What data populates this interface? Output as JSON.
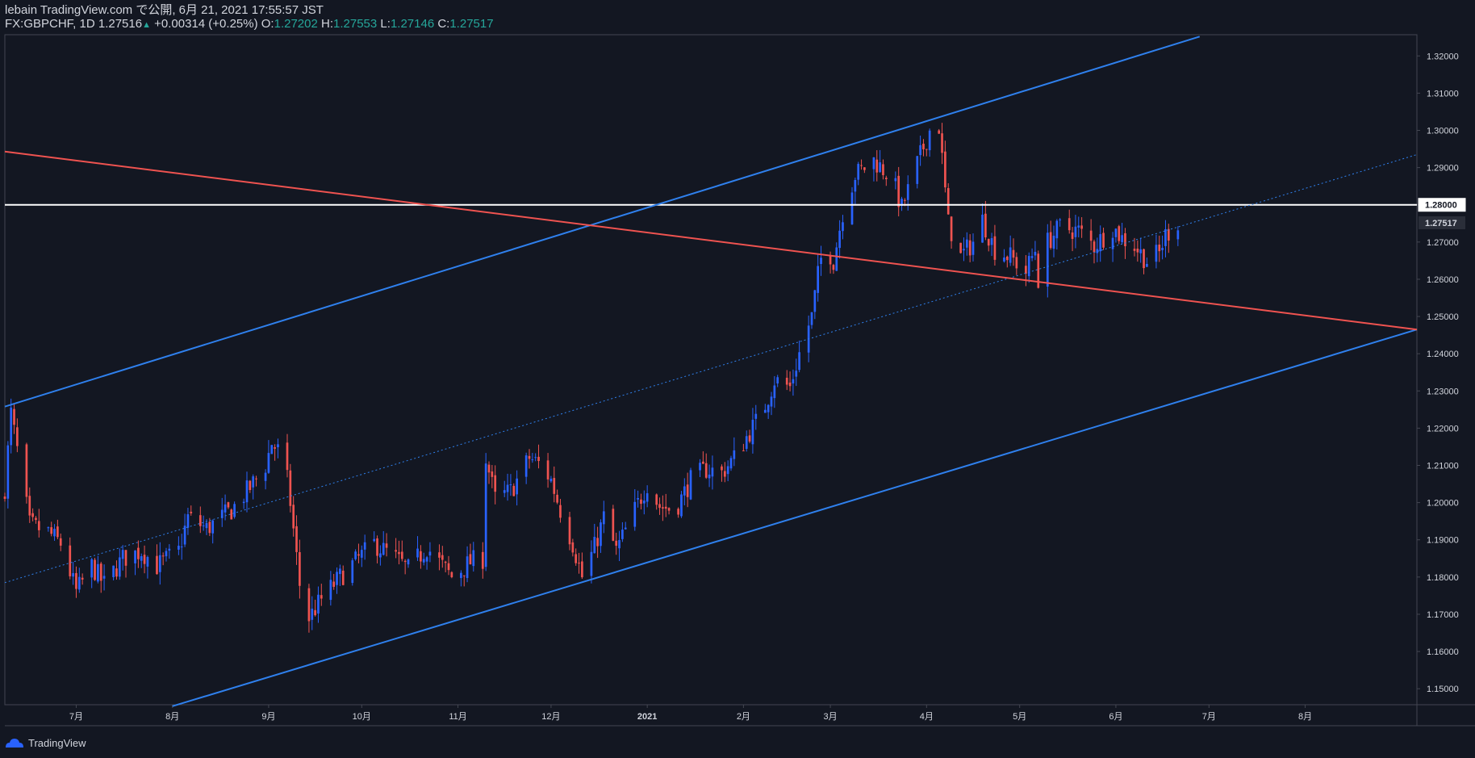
{
  "header": {
    "line1": "lebain TradingView.com で公開, 6月 21, 2021 17:55:57 JST",
    "symbol": "FX:GBPCHF, 1D",
    "last": "1.27516",
    "change": "+0.00314 (+0.25%)",
    "o_label": "O:",
    "o_value": "1.27202",
    "h_label": "H:",
    "h_value": "1.27553",
    "l_label": "L:",
    "l_value": "1.27146",
    "c_label": "C:",
    "c_value": "1.27517"
  },
  "footer": {
    "brand": "TradingView",
    "icon": "tradingview-logo-icon"
  },
  "colors": {
    "background": "#131722",
    "bull": "#2962ff",
    "bear": "#ef5350",
    "channel": "#2f80ed",
    "resistance_line": "#ef5350",
    "level_line": "#ffffff",
    "grid": "#2a2e39",
    "axis_text": "#d1d4dc"
  },
  "chart_data": {
    "type": "candlestick",
    "symbol": "FX:GBPCHF",
    "interval": "1D",
    "x_domain": [
      "2020-06-08",
      "2021-09-06"
    ],
    "ylim": [
      1.1457,
      1.3257
    ],
    "price_ticks": [
      "1.15000",
      "1.16000",
      "1.17000",
      "1.18000",
      "1.19000",
      "1.20000",
      "1.21000",
      "1.22000",
      "1.23000",
      "1.24000",
      "1.25000",
      "1.26000",
      "1.27000",
      "1.28000",
      "1.29000",
      "1.30000",
      "1.31000",
      "1.32000"
    ],
    "month_ticks": [
      {
        "date": "2020-07-01",
        "label": "7月"
      },
      {
        "date": "2020-08-01",
        "label": "8月"
      },
      {
        "date": "2020-09-01",
        "label": "9月"
      },
      {
        "date": "2020-10-01",
        "label": "10月"
      },
      {
        "date": "2020-11-01",
        "label": "11月"
      },
      {
        "date": "2020-12-01",
        "label": "12月"
      },
      {
        "date": "2021-01-01",
        "label": "2021"
      },
      {
        "date": "2021-02-01",
        "label": "2月"
      },
      {
        "date": "2021-03-01",
        "label": "3月"
      },
      {
        "date": "2021-04-01",
        "label": "4月"
      },
      {
        "date": "2021-05-01",
        "label": "5月"
      },
      {
        "date": "2021-06-01",
        "label": "6月"
      },
      {
        "date": "2021-07-01",
        "label": "7月"
      },
      {
        "date": "2021-08-01",
        "label": "8月"
      }
    ],
    "price_labels": [
      {
        "label": "1.28000",
        "price": 1.28,
        "style": "white"
      },
      {
        "label": "1.27517",
        "price": 1.27517,
        "style": "dark"
      }
    ],
    "horizontal_line": {
      "price": 1.28,
      "color": "#ffffff"
    },
    "trendlines": [
      {
        "name": "channel-upper",
        "color": "#2f80ed",
        "width": 2,
        "dash": false,
        "p1": [
          "2020-06-08",
          1.2258
        ],
        "p2": [
          "2021-06-28",
          1.3252
        ]
      },
      {
        "name": "channel-lower",
        "color": "#2f80ed",
        "width": 2,
        "dash": false,
        "p1": [
          "2020-08-01",
          1.1453
        ],
        "p2": [
          "2021-09-06",
          1.2465
        ]
      },
      {
        "name": "channel-middle",
        "color": "#2f80ed",
        "width": 1,
        "dash": true,
        "p1": [
          "2020-06-08",
          1.1785
        ],
        "p2": [
          "2021-09-06",
          1.2935
        ]
      },
      {
        "name": "descending-resistance",
        "color": "#ef5350",
        "width": 2,
        "dash": false,
        "p1": [
          "2020-06-08",
          1.2943
        ],
        "p2": [
          "2021-09-06",
          1.2465
        ]
      }
    ],
    "waypoints": [
      [
        "2020-06-08",
        1.204
      ],
      [
        "2020-06-10",
        1.224
      ],
      [
        "2020-06-16",
        1.194
      ],
      [
        "2020-06-22",
        1.192
      ],
      [
        "2020-06-26",
        1.189
      ],
      [
        "2020-07-01",
        1.176
      ],
      [
        "2020-07-06",
        1.183
      ],
      [
        "2020-07-10",
        1.178
      ],
      [
        "2020-07-16",
        1.185
      ],
      [
        "2020-07-22",
        1.187
      ],
      [
        "2020-07-27",
        1.183
      ],
      [
        "2020-08-03",
        1.187
      ],
      [
        "2020-08-06",
        1.196
      ],
      [
        "2020-08-12",
        1.193
      ],
      [
        "2020-08-20",
        1.198
      ],
      [
        "2020-08-26",
        1.204
      ],
      [
        "2020-08-31",
        1.21
      ],
      [
        "2020-09-02",
        1.216
      ],
      [
        "2020-09-06",
        1.212
      ],
      [
        "2020-09-08",
        1.2
      ],
      [
        "2020-09-11",
        1.178
      ],
      [
        "2020-09-14",
        1.169
      ],
      [
        "2020-09-18",
        1.174
      ],
      [
        "2020-09-24",
        1.18
      ],
      [
        "2020-09-30",
        1.185
      ],
      [
        "2020-10-05",
        1.189
      ],
      [
        "2020-10-12",
        1.185
      ],
      [
        "2020-10-16",
        1.182
      ],
      [
        "2020-10-22",
        1.188
      ],
      [
        "2020-10-27",
        1.183
      ],
      [
        "2020-10-30",
        1.18
      ],
      [
        "2020-11-05",
        1.184
      ],
      [
        "2020-11-09",
        1.185
      ],
      [
        "2020-11-10",
        1.212
      ],
      [
        "2020-11-13",
        1.201
      ],
      [
        "2020-11-18",
        1.203
      ],
      [
        "2020-11-24",
        1.212
      ],
      [
        "2020-11-28",
        1.21
      ],
      [
        "2020-12-01",
        1.206
      ],
      [
        "2020-12-04",
        1.198
      ],
      [
        "2020-12-08",
        1.189
      ],
      [
        "2020-12-11",
        1.18
      ],
      [
        "2020-12-15",
        1.188
      ],
      [
        "2020-12-18",
        1.196
      ],
      [
        "2020-12-22",
        1.187
      ],
      [
        "2020-12-28",
        1.198
      ],
      [
        "2021-01-01",
        1.205
      ],
      [
        "2021-01-05",
        1.199
      ],
      [
        "2021-01-10",
        1.198
      ],
      [
        "2021-01-15",
        1.206
      ],
      [
        "2021-01-20",
        1.209
      ],
      [
        "2021-01-25",
        1.208
      ],
      [
        "2021-01-29",
        1.212
      ],
      [
        "2021-02-03",
        1.219
      ],
      [
        "2021-02-07",
        1.224
      ],
      [
        "2021-02-11",
        1.233
      ],
      [
        "2021-02-16",
        1.231
      ],
      [
        "2021-02-20",
        1.243
      ],
      [
        "2021-02-23",
        1.25
      ],
      [
        "2021-02-25",
        1.261
      ],
      [
        "2021-02-27",
        1.27
      ],
      [
        "2021-03-02",
        1.265
      ],
      [
        "2021-03-05",
        1.278
      ],
      [
        "2021-03-09",
        1.288
      ],
      [
        "2021-03-15",
        1.292
      ],
      [
        "2021-03-21",
        1.287
      ],
      [
        "2021-03-24",
        1.279
      ],
      [
        "2021-03-29",
        1.291
      ],
      [
        "2021-04-02",
        1.3
      ],
      [
        "2021-04-05",
        1.301
      ],
      [
        "2021-04-08",
        1.275
      ],
      [
        "2021-04-12",
        1.266
      ],
      [
        "2021-04-16",
        1.27
      ],
      [
        "2021-04-19",
        1.276
      ],
      [
        "2021-04-23",
        1.268
      ],
      [
        "2021-04-28",
        1.266
      ],
      [
        "2021-05-03",
        1.262
      ],
      [
        "2021-05-06",
        1.268
      ],
      [
        "2021-05-07",
        1.26
      ],
      [
        "2021-05-10",
        1.27
      ],
      [
        "2021-05-14",
        1.274
      ],
      [
        "2021-05-20",
        1.273
      ],
      [
        "2021-05-25",
        1.269
      ],
      [
        "2021-05-31",
        1.274
      ],
      [
        "2021-06-03",
        1.271
      ],
      [
        "2021-06-07",
        1.269
      ],
      [
        "2021-06-11",
        1.265
      ],
      [
        "2021-06-15",
        1.267
      ],
      [
        "2021-06-17",
        1.272
      ],
      [
        "2021-06-21",
        1.2752
      ]
    ]
  }
}
